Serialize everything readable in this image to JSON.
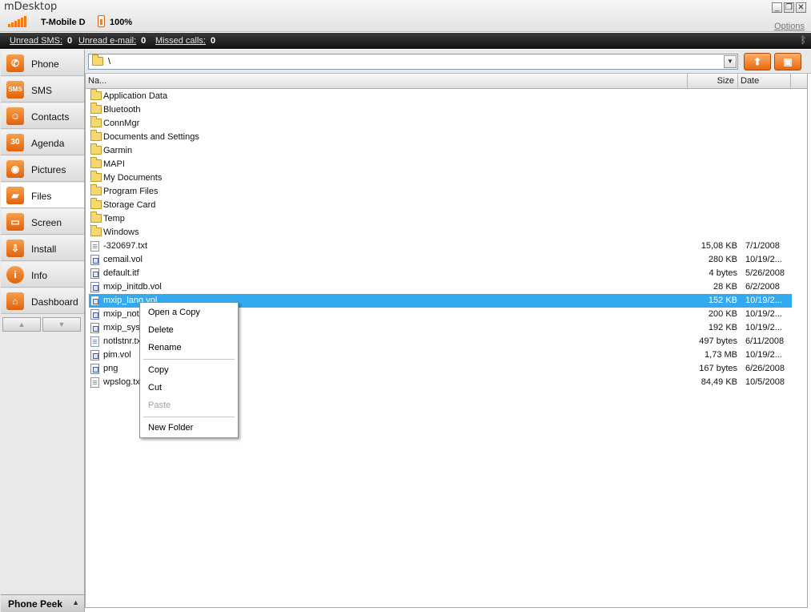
{
  "app": {
    "title": "mDesktop"
  },
  "device": {
    "carrier": "T-Mobile D",
    "battery": "100%"
  },
  "window": {
    "options_label": "Options",
    "minimize": "_",
    "restore": "❐",
    "close": "✕"
  },
  "status": {
    "sms_label": "Unread SMS:",
    "sms_count": "0",
    "email_label": "Unread e-mail:",
    "email_count": "0",
    "calls_label": "Missed calls:",
    "calls_count": "0"
  },
  "sidebar": {
    "items": [
      {
        "label": "Phone",
        "icon": "phone-icon"
      },
      {
        "label": "SMS",
        "icon": "sms-icon"
      },
      {
        "label": "Contacts",
        "icon": "contacts-icon"
      },
      {
        "label": "Agenda",
        "icon": "calendar-icon"
      },
      {
        "label": "Pictures",
        "icon": "camera-icon"
      },
      {
        "label": "Files",
        "icon": "folder-icon",
        "active": true
      },
      {
        "label": "Screen",
        "icon": "screen-icon"
      },
      {
        "label": "Install",
        "icon": "install-icon"
      },
      {
        "label": "Info",
        "icon": "info-icon"
      },
      {
        "label": "Dashboard",
        "icon": "home-icon"
      }
    ],
    "phone_peek": "Phone Peek"
  },
  "toolbar": {
    "path": "\\"
  },
  "columns": {
    "name": "Na...",
    "size": "Size",
    "date": "Date"
  },
  "files": [
    {
      "name": "Application Data",
      "type": "folder",
      "size": "",
      "date": ""
    },
    {
      "name": "Bluetooth",
      "type": "folder",
      "size": "",
      "date": ""
    },
    {
      "name": "ConnMgr",
      "type": "folder",
      "size": "",
      "date": ""
    },
    {
      "name": "Documents and Settings",
      "type": "folder",
      "size": "",
      "date": ""
    },
    {
      "name": "Garmin",
      "type": "folder",
      "size": "",
      "date": ""
    },
    {
      "name": "MAPI",
      "type": "folder",
      "size": "",
      "date": ""
    },
    {
      "name": "My Documents",
      "type": "folder",
      "size": "",
      "date": ""
    },
    {
      "name": "Program Files",
      "type": "folder",
      "size": "",
      "date": ""
    },
    {
      "name": "Storage Card",
      "type": "folder",
      "size": "",
      "date": ""
    },
    {
      "name": "Temp",
      "type": "folder",
      "size": "",
      "date": ""
    },
    {
      "name": "Windows",
      "type": "folder",
      "size": "",
      "date": ""
    },
    {
      "name": "-320697.txt",
      "type": "txt",
      "size": "15,08 KB",
      "date": "7/1/2008"
    },
    {
      "name": "cemail.vol",
      "type": "file",
      "size": "280 KB",
      "date": "10/19/2..."
    },
    {
      "name": "default.itf",
      "type": "file",
      "size": "4 bytes",
      "date": "5/26/2008"
    },
    {
      "name": "mxip_initdb.vol",
      "type": "file",
      "size": "28 KB",
      "date": "6/2/2008"
    },
    {
      "name": "mxip_lang.vol",
      "type": "file",
      "size": "152 KB",
      "date": "10/19/2...",
      "selected": true
    },
    {
      "name": "mxip_noti",
      "type": "file",
      "size": "200 KB",
      "date": "10/19/2..."
    },
    {
      "name": "mxip_syst",
      "type": "file",
      "size": "192 KB",
      "date": "10/19/2..."
    },
    {
      "name": "notlstnr.tx",
      "type": "txt",
      "size": "497 bytes",
      "date": "6/11/2008"
    },
    {
      "name": "pim.vol",
      "type": "file",
      "size": "1,73 MB",
      "date": "10/19/2..."
    },
    {
      "name": "png",
      "type": "file",
      "size": "167 bytes",
      "date": "6/26/2008"
    },
    {
      "name": "wpslog.txt",
      "type": "txt",
      "size": "84,49 KB",
      "date": "10/5/2008"
    }
  ],
  "context_menu": {
    "open_copy": "Open a Copy",
    "delete": "Delete",
    "rename": "Rename",
    "copy": "Copy",
    "cut": "Cut",
    "paste": "Paste",
    "new_folder": "New Folder"
  },
  "colors": {
    "accent": "#f07d1a",
    "selection": "#33a9ef"
  }
}
